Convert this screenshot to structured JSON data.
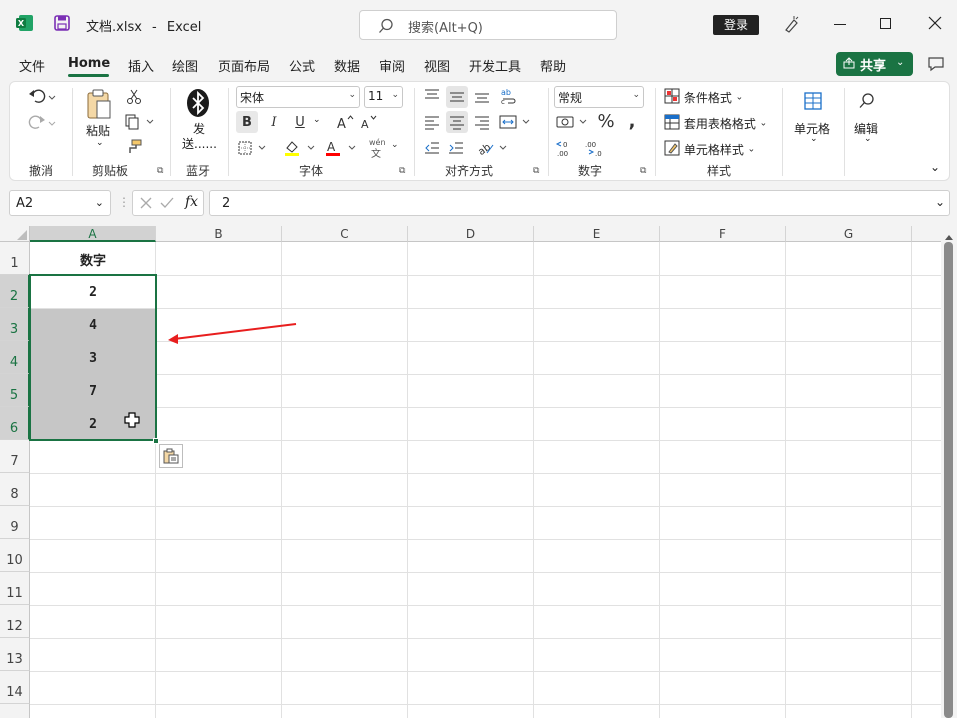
{
  "window": {
    "file_name": "文档.xlsx",
    "separator": "-",
    "app_name": "Excel",
    "search_placeholder": "搜索(Alt+Q)",
    "login_label": "登录"
  },
  "menu": {
    "items": [
      "文件",
      "Home",
      "插入",
      "绘图",
      "页面布局",
      "公式",
      "数据",
      "审阅",
      "视图",
      "开发工具",
      "帮助"
    ],
    "active_index": 1,
    "share_label": "共享"
  },
  "ribbon": {
    "groups": {
      "undo": "撤消",
      "clipboard": "剪贴板",
      "bluetooth": "蓝牙",
      "font": "字体",
      "alignment": "对齐方式",
      "number": "数字",
      "styles": "样式"
    },
    "paste_label": "粘贴",
    "send_label": "发送......",
    "font_name": "宋体",
    "font_size": "11",
    "bold": "B",
    "italic": "I",
    "underline": "U",
    "number_format": "常规",
    "conditional_format": "条件格式",
    "table_format": "套用表格格式",
    "cell_style": "单元格样式",
    "cells_label": "单元格",
    "edit_label": "编辑",
    "phonetic": "wén"
  },
  "formula_bar": {
    "name_box": "A2",
    "fx": "fx",
    "value": "2"
  },
  "sheet": {
    "columns": [
      "A",
      "B",
      "C",
      "D",
      "E",
      "F",
      "G"
    ],
    "rows": [
      "1",
      "2",
      "3",
      "4",
      "5",
      "6",
      "7",
      "8",
      "9",
      "10",
      "11",
      "12",
      "13",
      "14"
    ],
    "cells": {
      "A1": "数字",
      "A2": "2",
      "A3": "4",
      "A4": "3",
      "A5": "7",
      "A6": "2"
    }
  },
  "colors": {
    "accent": "#1a7343",
    "selection_fill": "#c6c6c6",
    "arrow": "#e81e1e",
    "excel_green": "#107c41"
  }
}
